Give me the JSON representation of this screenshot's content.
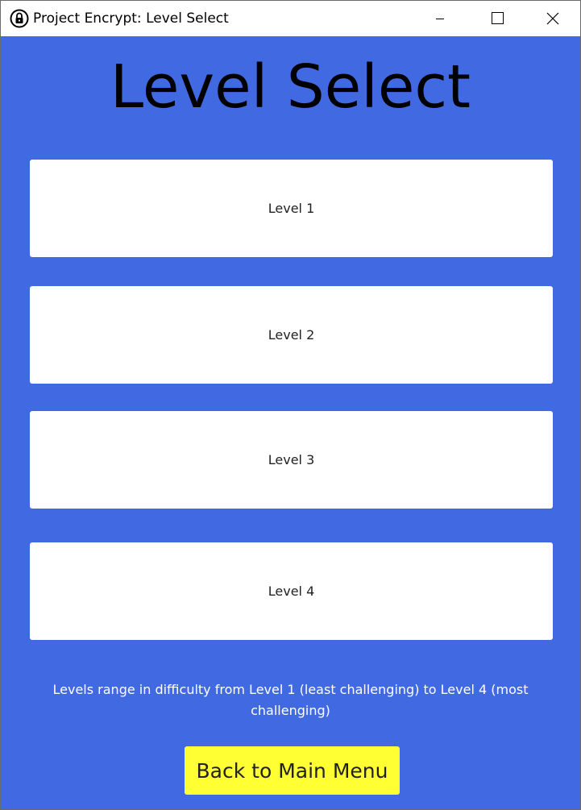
{
  "window": {
    "title": "Project Encrypt: Level Select",
    "icon": "lock-icon",
    "controls": [
      "minimize-icon",
      "maximize-icon",
      "close-icon"
    ]
  },
  "main": {
    "heading": "Level Select",
    "levels": [
      {
        "label": "Level 1"
      },
      {
        "label": "Level 2"
      },
      {
        "label": "Level 3"
      },
      {
        "label": "Level 4"
      }
    ],
    "note": "Levels range in difficulty from Level 1 (least challenging) to Level 4 (most challenging)",
    "back_label": "Back to Main Menu"
  },
  "colors": {
    "background": "#4169e1",
    "level_button": "#ffffff",
    "back_button": "#ffff33"
  }
}
